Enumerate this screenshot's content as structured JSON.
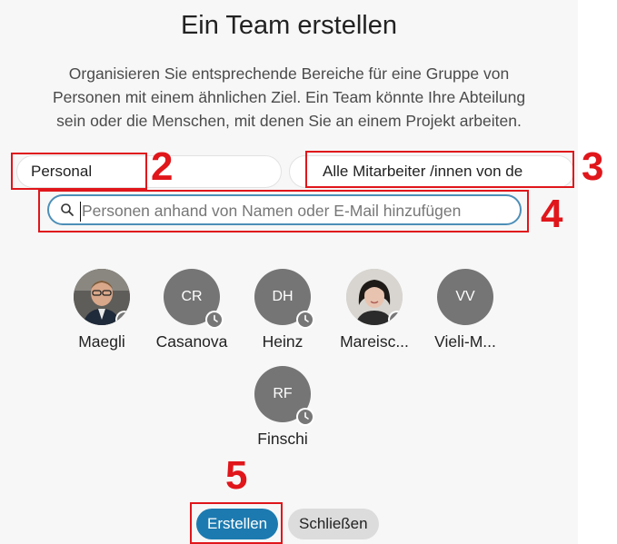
{
  "title": "Ein Team erstellen",
  "description_lines": [
    "Organisieren Sie entsprechende Bereiche für eine Gruppe von",
    "Personen mit einem ähnlichen Ziel. Ein Team könnte Ihre Abteilung",
    "sein oder die Menschen, mit denen Sie an einem Projekt arbeiten."
  ],
  "team_name": {
    "value": "Personal"
  },
  "group_field": {
    "value": "Alle Mitarbeiter /innen von de"
  },
  "search": {
    "placeholder": "Personen anhand von Namen oder E-Mail hinzufügen",
    "icon": "search-icon"
  },
  "members": [
    {
      "name": "Maegli",
      "initials": "",
      "type": "photo"
    },
    {
      "name": "Casanova",
      "initials": "CR",
      "type": "initials"
    },
    {
      "name": "Heinz",
      "initials": "DH",
      "type": "initials"
    },
    {
      "name": "Mareisc...",
      "initials": "",
      "type": "photo"
    },
    {
      "name": "Vieli-M...",
      "initials": "VV",
      "type": "initials"
    },
    {
      "name": "Finschi",
      "initials": "RF",
      "type": "initials"
    }
  ],
  "buttons": {
    "create": "Erstellen",
    "close": "Schließen"
  },
  "annotations": {
    "n2": "2",
    "n3": "3",
    "n4": "4",
    "n5": "5"
  },
  "colors": {
    "annotation_red": "#e0161b",
    "primary": "#1c7ab0",
    "search_border": "#4d8fb8"
  }
}
